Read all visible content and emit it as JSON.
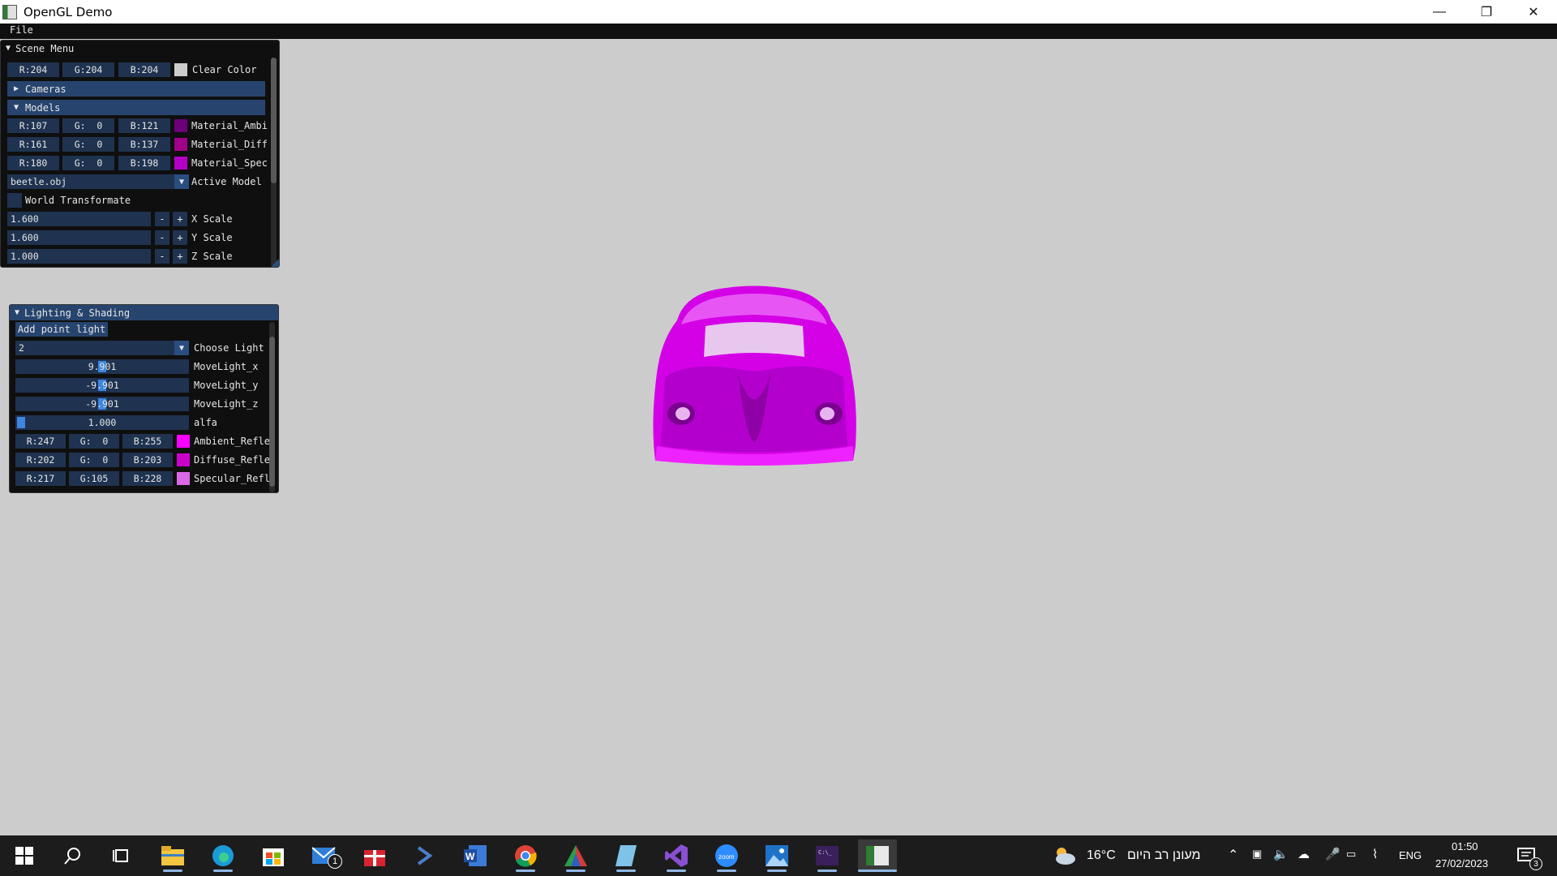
{
  "window": {
    "title": "OpenGL Demo",
    "minimize_icon": "minimize-icon",
    "maximize_icon": "restore-icon",
    "close_icon": "close-icon"
  },
  "menubar": {
    "file": "File"
  },
  "scene_menu": {
    "title": "Scene Menu",
    "clear_color": {
      "r": "R:204",
      "g": "G:204",
      "b": "B:204",
      "label": "Clear Color",
      "swatch": "#cccccc"
    },
    "cameras_header": "Cameras",
    "models_header": "Models",
    "materials": [
      {
        "r": "R:107",
        "g": "G:  0",
        "b": "B:121",
        "label": "Material_Ambi",
        "swatch": "#6b0079"
      },
      {
        "r": "R:161",
        "g": "G:  0",
        "b": "B:137",
        "label": "Material_Diff",
        "swatch": "#a10089"
      },
      {
        "r": "R:180",
        "g": "G:  0",
        "b": "B:198",
        "label": "Material_Spec",
        "swatch": "#b400c6"
      }
    ],
    "active_model": {
      "value": "beetle.obj",
      "label": "Active Model"
    },
    "world_transform": "World Transformate",
    "scales": [
      {
        "value": "1.600",
        "label": "X Scale",
        "minus": "-",
        "plus": "+"
      },
      {
        "value": "1.600",
        "label": "Y Scale",
        "minus": "-",
        "plus": "+"
      },
      {
        "value": "1.000",
        "label": "Z Scale",
        "minus": "-",
        "plus": "+"
      }
    ]
  },
  "lighting": {
    "title": "Lighting & Shading",
    "add_light": "Add point light",
    "choose_light": {
      "value": "2",
      "label": "Choose Light"
    },
    "sliders": [
      {
        "value": "9.901",
        "label": "MoveLight_x",
        "fraction": 0.5
      },
      {
        "value": "-9.901",
        "label": "MoveLight_y",
        "fraction": 0.5
      },
      {
        "value": "-9.901",
        "label": "MoveLight_z",
        "fraction": 0.5
      }
    ],
    "alfa": {
      "value": "1.000",
      "label": "alfa",
      "fraction": 0.0
    },
    "colors": [
      {
        "r": "R:247",
        "g": "G:  0",
        "b": "B:255",
        "label": "Ambient_Refle",
        "swatch": "#f700ff"
      },
      {
        "r": "R:202",
        "g": "G:  0",
        "b": "B:203",
        "label": "Diffuse_Refle",
        "swatch": "#ca00cb"
      },
      {
        "r": "R:217",
        "g": "G:105",
        "b": "B:228",
        "label": "Specular_Refl",
        "swatch": "#d969e4"
      }
    ]
  },
  "taskbar": {
    "weather_temp": "16°C",
    "weather_text": "מעונן רב היום",
    "language": "ENG",
    "time": "01:50",
    "date": "27/02/2023",
    "mail_badge": "1",
    "notif_badge": "3"
  }
}
